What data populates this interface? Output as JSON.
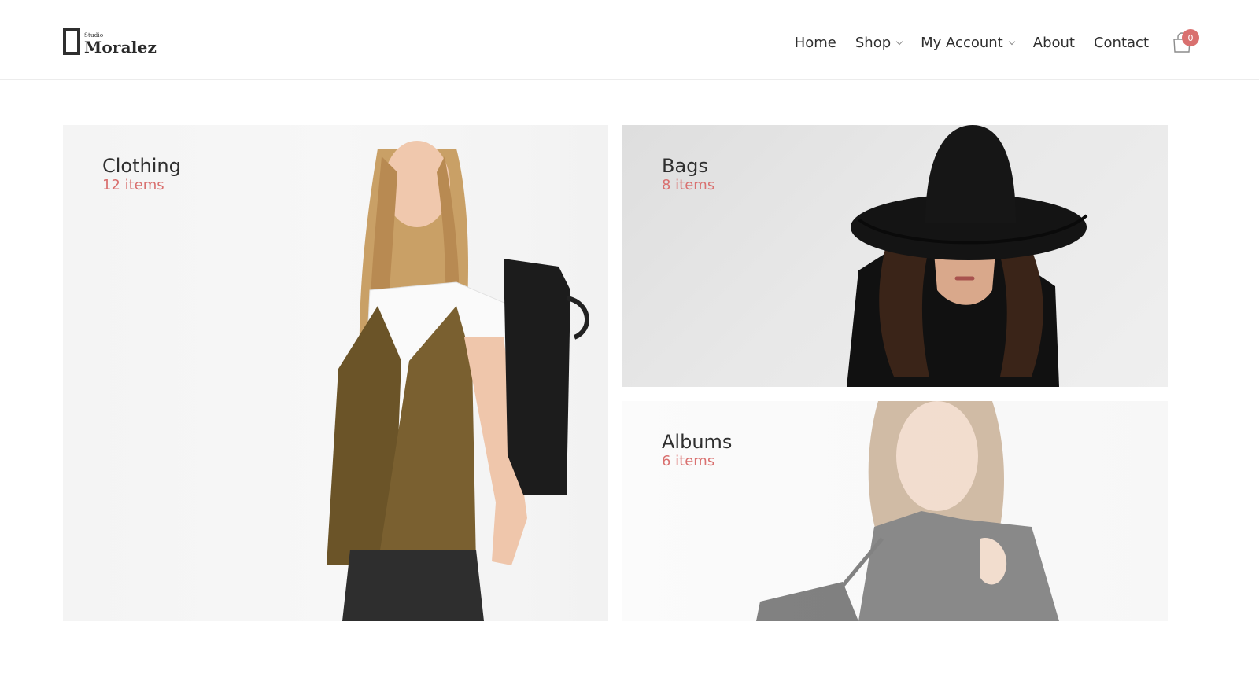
{
  "brand": {
    "small": "Studio",
    "name": "Moralez"
  },
  "nav": {
    "home": "Home",
    "shop": "Shop",
    "account": "My Account",
    "about": "About",
    "contact": "Contact"
  },
  "cart": {
    "count": "0",
    "icon": "shopping-bag-icon"
  },
  "colors": {
    "accent": "#d9706f",
    "text": "#2f2f2f",
    "border": "#ececec"
  },
  "categories": [
    {
      "title": "Clothing",
      "count": "12 items"
    },
    {
      "title": "Bags",
      "count": "8 items"
    },
    {
      "title": "Albums",
      "count": "6 items"
    }
  ]
}
